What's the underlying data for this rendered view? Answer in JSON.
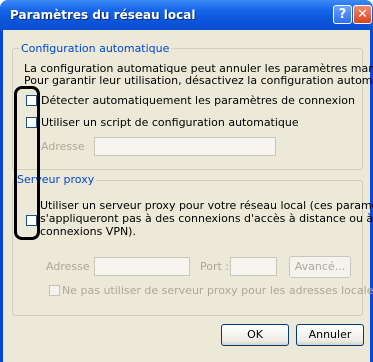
{
  "window": {
    "title": "Paramètres du réseau local"
  },
  "titlebar": {
    "help_glyph": "?",
    "close_glyph": "✕"
  },
  "auto_config": {
    "legend": "Configuration automatique",
    "description_line1": "La configuration automatique peut annuler les paramètres manuels.",
    "description_line2": "Pour garantir leur utilisation, désactivez la configuration automatique.",
    "detect_label": "Détecter automatiquement les paramètres de connexion",
    "detect_checked": false,
    "script_label": "Utiliser un script de configuration automatique",
    "script_checked": false,
    "address_label": "Adresse",
    "address_value": ""
  },
  "proxy": {
    "legend": "Serveur proxy",
    "use_proxy_line1": "Utiliser un serveur proxy pour votre réseau local (ces paramètres ne",
    "use_proxy_line2": "s'appliqueront pas à des connexions d'accès à distance ou à des",
    "use_proxy_line3": "connexions VPN).",
    "use_proxy_checked": false,
    "address_label": "Adresse :",
    "address_value": "",
    "port_label": "Port :",
    "port_value": "",
    "advanced_label": "Avancé...",
    "bypass_label": "Ne pas utiliser de serveur proxy pour les adresses locales",
    "bypass_checked": false
  },
  "buttons": {
    "ok_label": "OK",
    "cancel_label": "Annuler"
  },
  "colors": {
    "titlebar": "#0c55d9",
    "dialog_bg": "#ece9d8",
    "legend": "#0046d5",
    "highlight": "#000000"
  }
}
